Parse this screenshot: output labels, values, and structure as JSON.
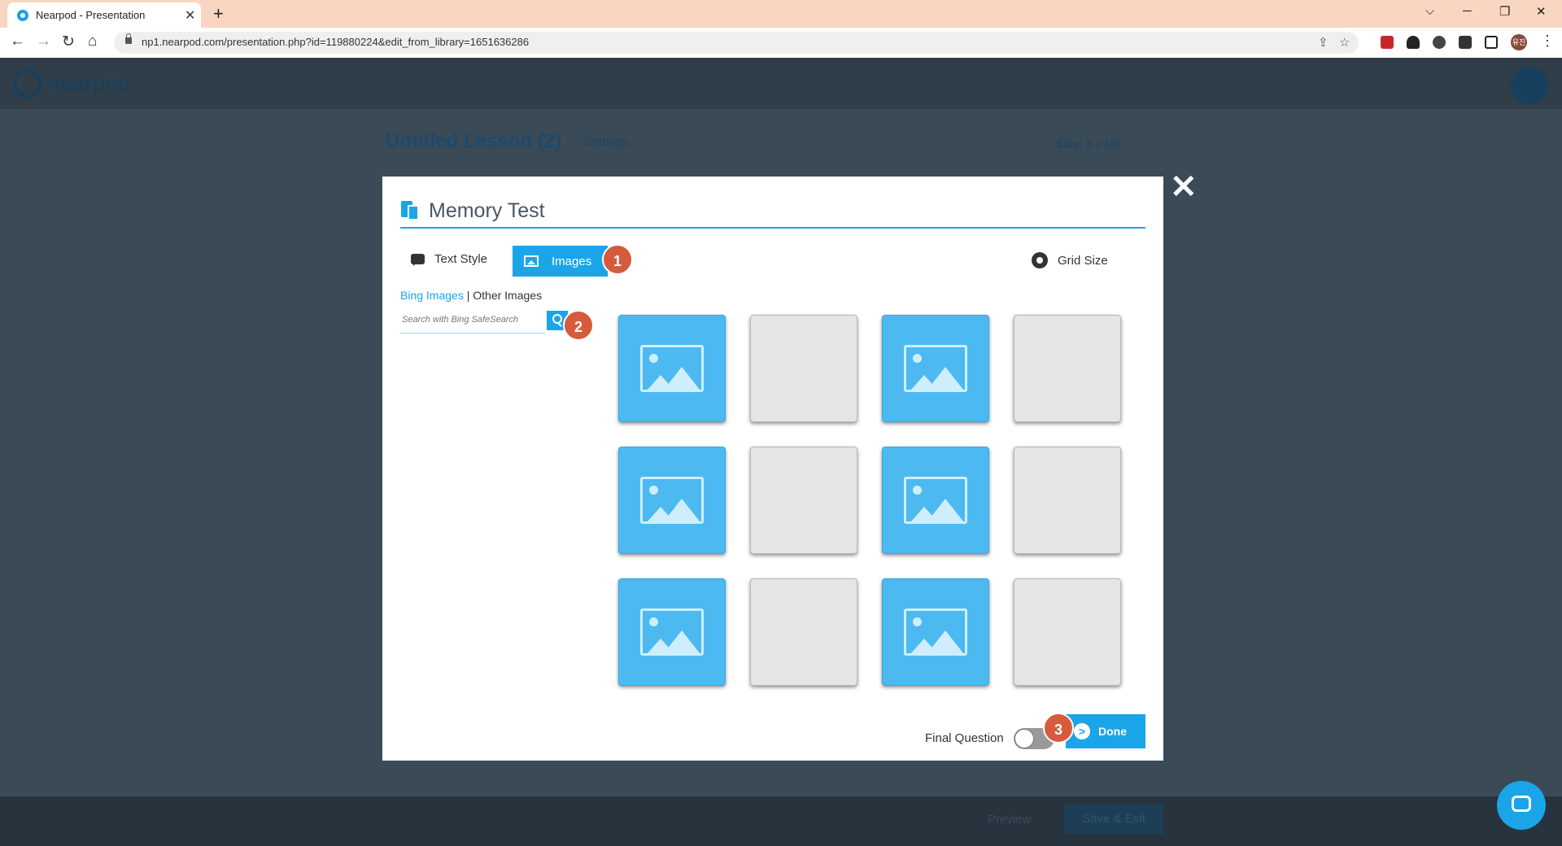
{
  "browser": {
    "tab_title": "Nearpod - Presentation",
    "tab_close": "✕",
    "new_tab": "+",
    "url": "np1.nearpod.com/presentation.php?id=119880224&edit_from_library=1651636286",
    "profile_initials": "유진"
  },
  "app": {
    "logo_text": "nearpod",
    "lesson_title": "Untitled Lesson (2)",
    "settings_label": "Settings",
    "size_label": "Size:",
    "size_value": "3.2 MB",
    "preview_label": "Preview",
    "save_exit_label": "Save & Exit"
  },
  "modal": {
    "close": "✕",
    "title": "Memory Test",
    "tabs": {
      "text_style": "Text Style",
      "images": "Images"
    },
    "grid_size_label": "Grid Size",
    "image_sources": {
      "bing": "Bing Images",
      "separator": "|",
      "other": "Other Images"
    },
    "search_placeholder": "Search with Bing SafeSearch",
    "cards": [
      "image",
      "blank",
      "image",
      "blank",
      "image",
      "blank",
      "image",
      "blank",
      "image",
      "blank",
      "image",
      "blank"
    ],
    "final_question_label": "Final Question",
    "done_label": "Done",
    "done_arrow": ">"
  },
  "badges": [
    "1",
    "2",
    "3"
  ],
  "colors": {
    "accent": "#1aa5e8",
    "badge": "#d65b3c",
    "tab_bar": "#f8d6c2",
    "overlay": "#3a4a57"
  }
}
